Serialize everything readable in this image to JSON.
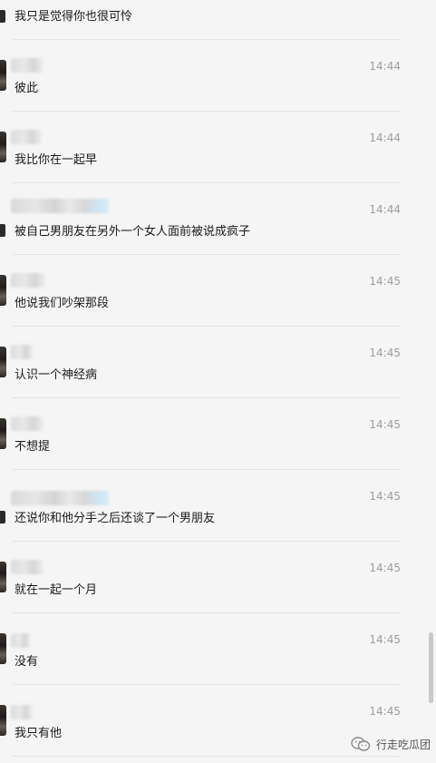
{
  "messages": [
    {
      "text": "我只是觉得你也很可怜",
      "time": ""
    },
    {
      "text": "彼此",
      "time": "14:44"
    },
    {
      "text": "我比你在一起早",
      "time": "14:44"
    },
    {
      "text": "被自己男朋友在另外一个女人面前被说成疯子",
      "time": "14:44"
    },
    {
      "text": "他说我们吵架那段",
      "time": "14:45"
    },
    {
      "text": "认识一个神经病",
      "time": "14:45"
    },
    {
      "text": "不想提",
      "time": "14:45"
    },
    {
      "text": "还说你和他分手之后还谈了一个男朋友",
      "time": "14:45"
    },
    {
      "text": "就在一起一个月",
      "time": "14:45"
    },
    {
      "text": "没有",
      "time": "14:45"
    },
    {
      "text": "我只有他",
      "time": "14:45"
    }
  ],
  "watermark": {
    "text": "行走吃瓜团",
    "icon": "wechat-official-account-icon"
  },
  "colors": {
    "background": "#f5f5f5",
    "timestamp": "#9d9d9d",
    "message_text": "#1a1a1a",
    "divider": "#e3e3e3"
  }
}
